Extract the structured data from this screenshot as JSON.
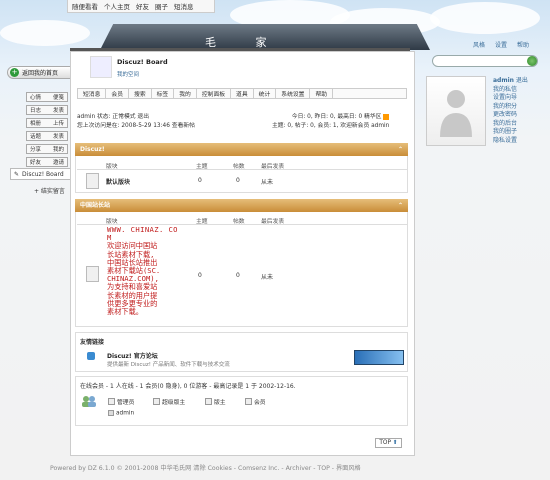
{
  "topnav": [
    "随便看看",
    "个人主页",
    "好友",
    "圈子",
    "短消息"
  ],
  "header": {
    "title": "毛 家"
  },
  "right_links": [
    "风格",
    "设置",
    "帮助"
  ],
  "profile": {
    "username": "admin",
    "logout": "退出",
    "links": [
      "我的私信",
      "设置向导",
      "我的积分",
      "更改密码",
      "我的后台",
      "我的圈子",
      "隐私设置"
    ]
  },
  "left": {
    "back": "返回我的首页",
    "menu": [
      [
        "心情",
        "便笺"
      ],
      [
        "日志",
        "发表"
      ],
      [
        "相册",
        "上传"
      ],
      [
        "话题",
        "发表"
      ],
      [
        "分享",
        "我的"
      ],
      [
        "好友",
        "邀请"
      ]
    ],
    "board": "Discuz! Board",
    "tree": "+ 结实留言"
  },
  "board": {
    "title": "Discuz! Board",
    "subtitle": "我的空间"
  },
  "menubar": [
    "短消息",
    "会员",
    "搜索",
    "标签",
    "我的",
    "控制面板",
    "道具",
    "统计",
    "系统设置",
    "帮助"
  ],
  "userinfo": {
    "line1": "admin 状态: 正常模式 退出",
    "line2": "您上次访问是在: 2008-5-29 13:46 查看新帖"
  },
  "stats": {
    "line1": "今日: 0, 昨日: 0, 最高日: 0  精华区",
    "line2": "主题: 0, 帖子: 0, 会员: 1, 欢迎新会员 admin"
  },
  "section1": {
    "title": "Discuz!",
    "cols": [
      "版块",
      "主题",
      "帖数",
      "最后发表"
    ],
    "row": [
      "默认版块",
      "0",
      "0",
      "从未"
    ]
  },
  "section2": {
    "title": "中国站长站",
    "cols": [
      "版块",
      "主题",
      "帖数",
      "最后发表"
    ],
    "row": [
      "0",
      "0",
      "从未"
    ]
  },
  "promo": {
    "line1": "WWW. CHINAZ. CO",
    "line2": "M",
    "body": [
      "欢迎访问中国站",
      "长站素材下载,",
      "中国站长站推出",
      "素材下载站(SC.",
      "CHINAZ.COM),",
      "为支持和喜爱站",
      "长素材的用户提",
      "供更多更专业的",
      "素材下载。"
    ]
  },
  "friends": {
    "title": "友情链接",
    "name": "Discuz! 官方论坛",
    "desc": "提供最新 Discuz! 产品新闻、软件下载与技术交流"
  },
  "online": {
    "title": "在线会员 - 1 人在线 - 1 会员(0 隐身), 0 位游客 - 最高记录是 1 于 2002-12-16.",
    "legend": [
      "管理员",
      "超级版主",
      "版主",
      "会员"
    ],
    "user": "admin"
  },
  "top_button": "TOP",
  "footer": "Powered by DZ 6.1.0 © 2001-2008 中华毛氏网 清除 Cookies - Comsenz Inc. - Archiver - TOP - 界面风格"
}
